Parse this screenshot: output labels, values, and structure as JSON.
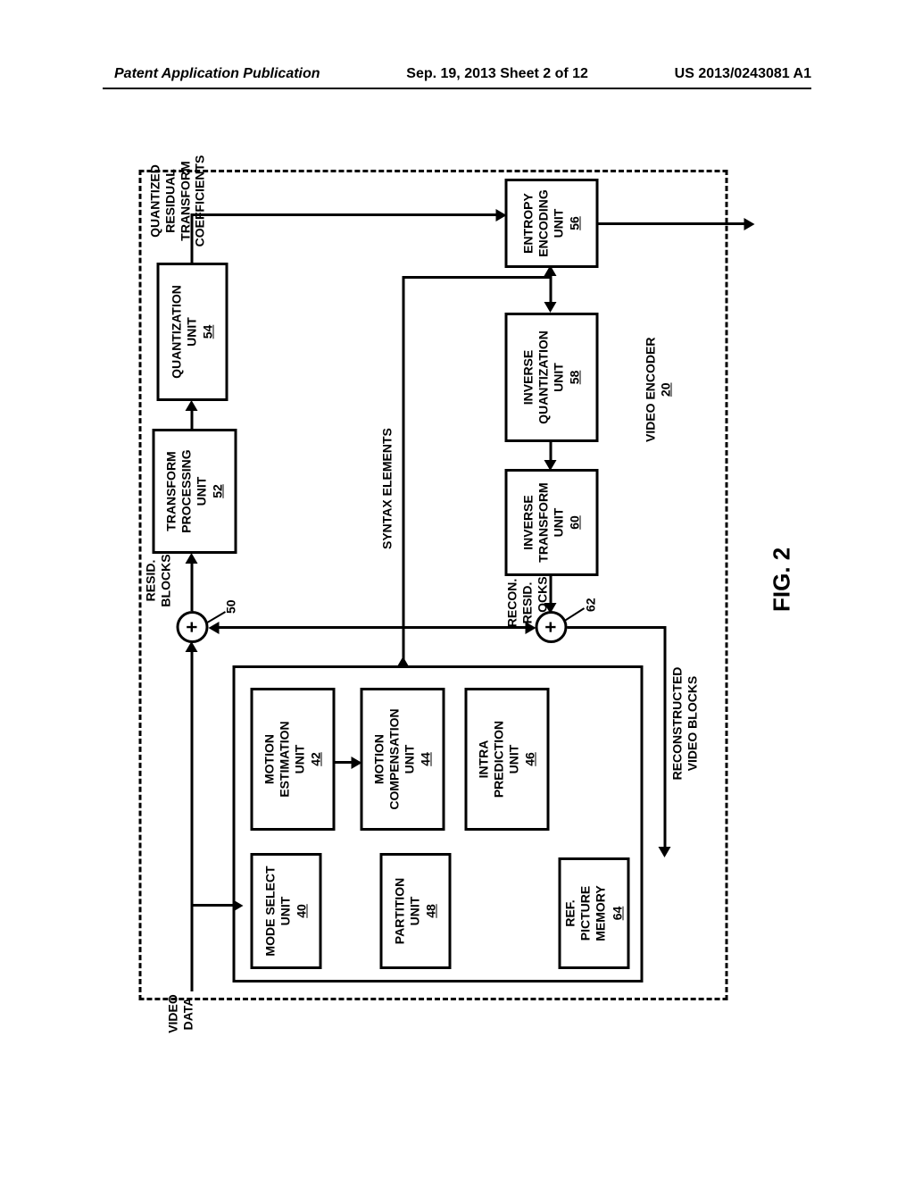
{
  "header": {
    "left": "Patent Application Publication",
    "center": "Sep. 19, 2013  Sheet 2 of 12",
    "right": "US 2013/0243081 A1"
  },
  "figure_caption": "FIG. 2",
  "labels": {
    "video_data": "VIDEO\nDATA",
    "resid_blocks": "RESID.\nBLOCKS",
    "quantized": "QUANTIZED\nRESIDUAL\nTRANSFORM\nCOEFFICIENTS",
    "syntax": "SYNTAX ELEMENTS",
    "recon_resid": "RECON.\nRESID.\nBLOCKS",
    "reconstructed": "RECONSTRUCTED\nVIDEO BLOCKS",
    "video_encoder": "VIDEO ENCODER",
    "video_encoder_num": "20",
    "sum50": "50",
    "sum62": "62"
  },
  "blocks": {
    "mode_select": {
      "t1": "MODE SELECT",
      "t2": "UNIT",
      "num": "40"
    },
    "motion_est": {
      "t1": "MOTION",
      "t2": "ESTIMATION",
      "t3": "UNIT",
      "num": "42"
    },
    "motion_comp": {
      "t1": "MOTION",
      "t2": "COMPENSATION",
      "t3": "UNIT",
      "num": "44"
    },
    "intra_pred": {
      "t1": "INTRA",
      "t2": "PREDICTION",
      "t3": "UNIT",
      "num": "46"
    },
    "partition": {
      "t1": "PARTITION",
      "t2": "UNIT",
      "num": "48"
    },
    "transform_proc": {
      "t1": "TRANSFORM",
      "t2": "PROCESSING",
      "t3": "UNIT",
      "num": "52"
    },
    "quantization": {
      "t1": "QUANTIZATION",
      "t2": "UNIT",
      "num": "54"
    },
    "entropy": {
      "t1": "ENTROPY",
      "t2": "ENCODING",
      "t3": "UNIT",
      "num": "56"
    },
    "inv_quant": {
      "t1": "INVERSE",
      "t2": "QUANTIZATION",
      "t3": "UNIT",
      "num": "58"
    },
    "inv_transform": {
      "t1": "INVERSE",
      "t2": "TRANSFORM",
      "t3": "UNIT",
      "num": "60"
    },
    "ref_memory": {
      "t1": "REF.",
      "t2": "PICTURE",
      "t3": "MEMORY",
      "num": "64"
    }
  }
}
